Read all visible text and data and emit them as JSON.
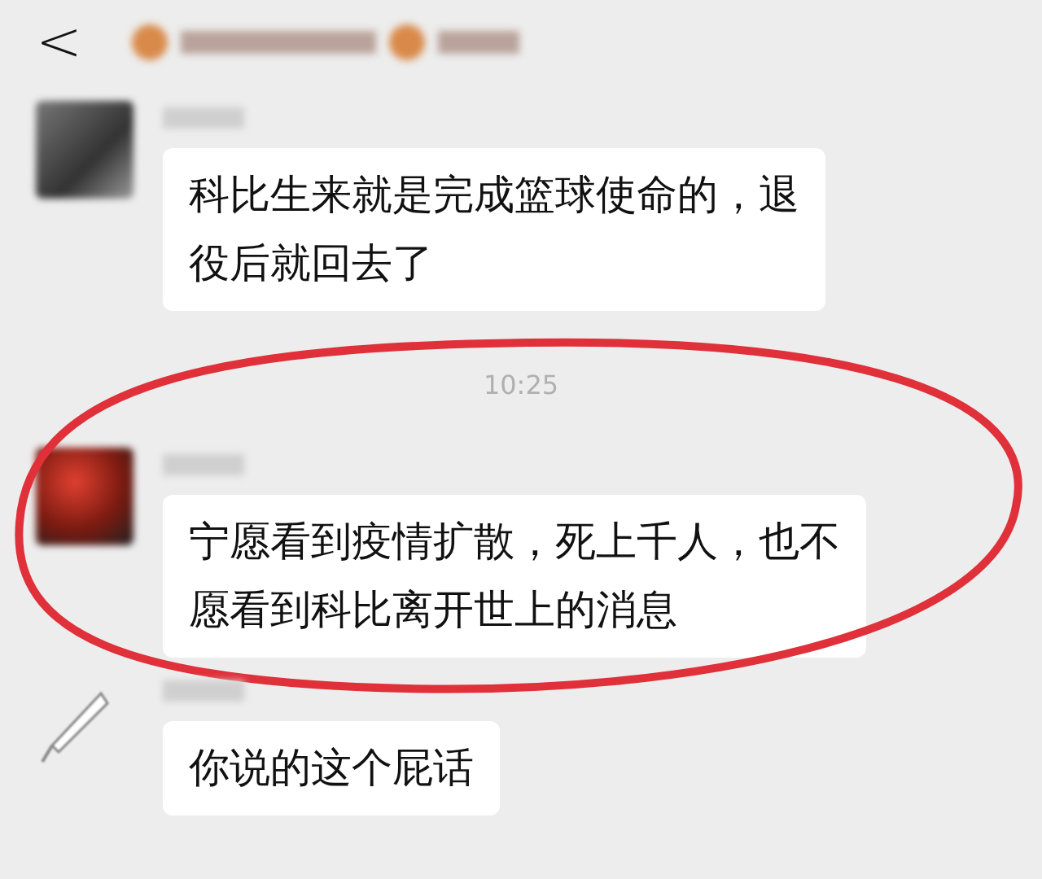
{
  "header": {
    "back": "<"
  },
  "messages": [
    {
      "kind": "dark",
      "lines": [
        "科比生来就是完成篮球使命的，退",
        "役后就回去了"
      ],
      "highlighted": false
    },
    {
      "kind": "time",
      "text": "10:25"
    },
    {
      "kind": "red",
      "lines": [
        "宁愿看到疫情扩散，死上千人，也不",
        "愿看到科比离开世上的消息"
      ],
      "highlighted": true
    },
    {
      "kind": "sketch",
      "lines": [
        "你说的这个屁话"
      ],
      "highlighted": false
    }
  ]
}
